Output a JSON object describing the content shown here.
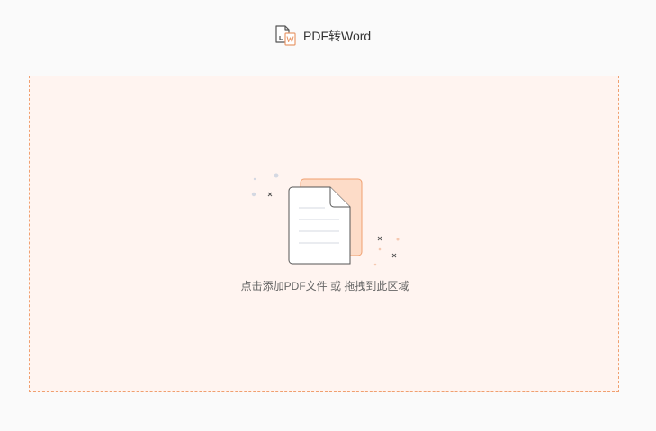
{
  "header": {
    "title": "PDF转Word",
    "icon": "pdf-to-word-icon"
  },
  "dropzone": {
    "hint": "点击添加PDF文件 或 拖拽到此区域",
    "icon": "document-upload-icon"
  },
  "colors": {
    "accent": "#f0a070",
    "dropzone_bg": "#fff4f0",
    "page_bg": "#fafafa",
    "back_document": "#fddcc8"
  }
}
